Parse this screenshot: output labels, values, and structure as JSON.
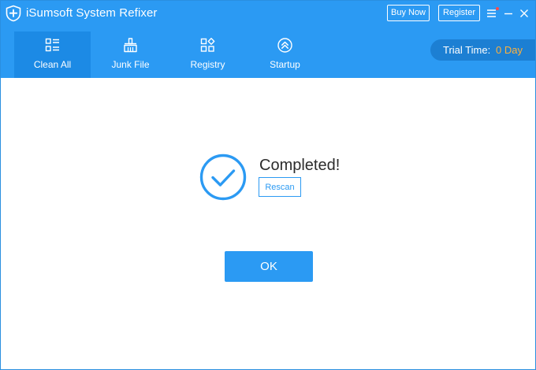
{
  "app": {
    "title": "iSumsoft System Refixer"
  },
  "titlebar": {
    "buy_now_label": "Buy Now",
    "register_label": "Register",
    "icons": [
      "menu-icon",
      "minimize-icon",
      "close-icon"
    ]
  },
  "nav": {
    "tabs": [
      {
        "label": "Clean All",
        "icon": "clean-all-icon",
        "active": true
      },
      {
        "label": "Junk File",
        "icon": "broom-icon",
        "active": false
      },
      {
        "label": "Registry",
        "icon": "registry-icon",
        "active": false
      },
      {
        "label": "Startup",
        "icon": "startup-icon",
        "active": false
      }
    ]
  },
  "trial": {
    "label": "Trial Time:",
    "value": "0 Day"
  },
  "status": {
    "title": "Completed!",
    "rescan_label": "Rescan",
    "ok_label": "OK"
  },
  "colors": {
    "accent": "#2b9af3",
    "active_tab": "#1c8ae5",
    "trial_bg": "#1c7fd3",
    "trial_value": "#ffb13b",
    "notification_dot": "#ff4a4a"
  }
}
